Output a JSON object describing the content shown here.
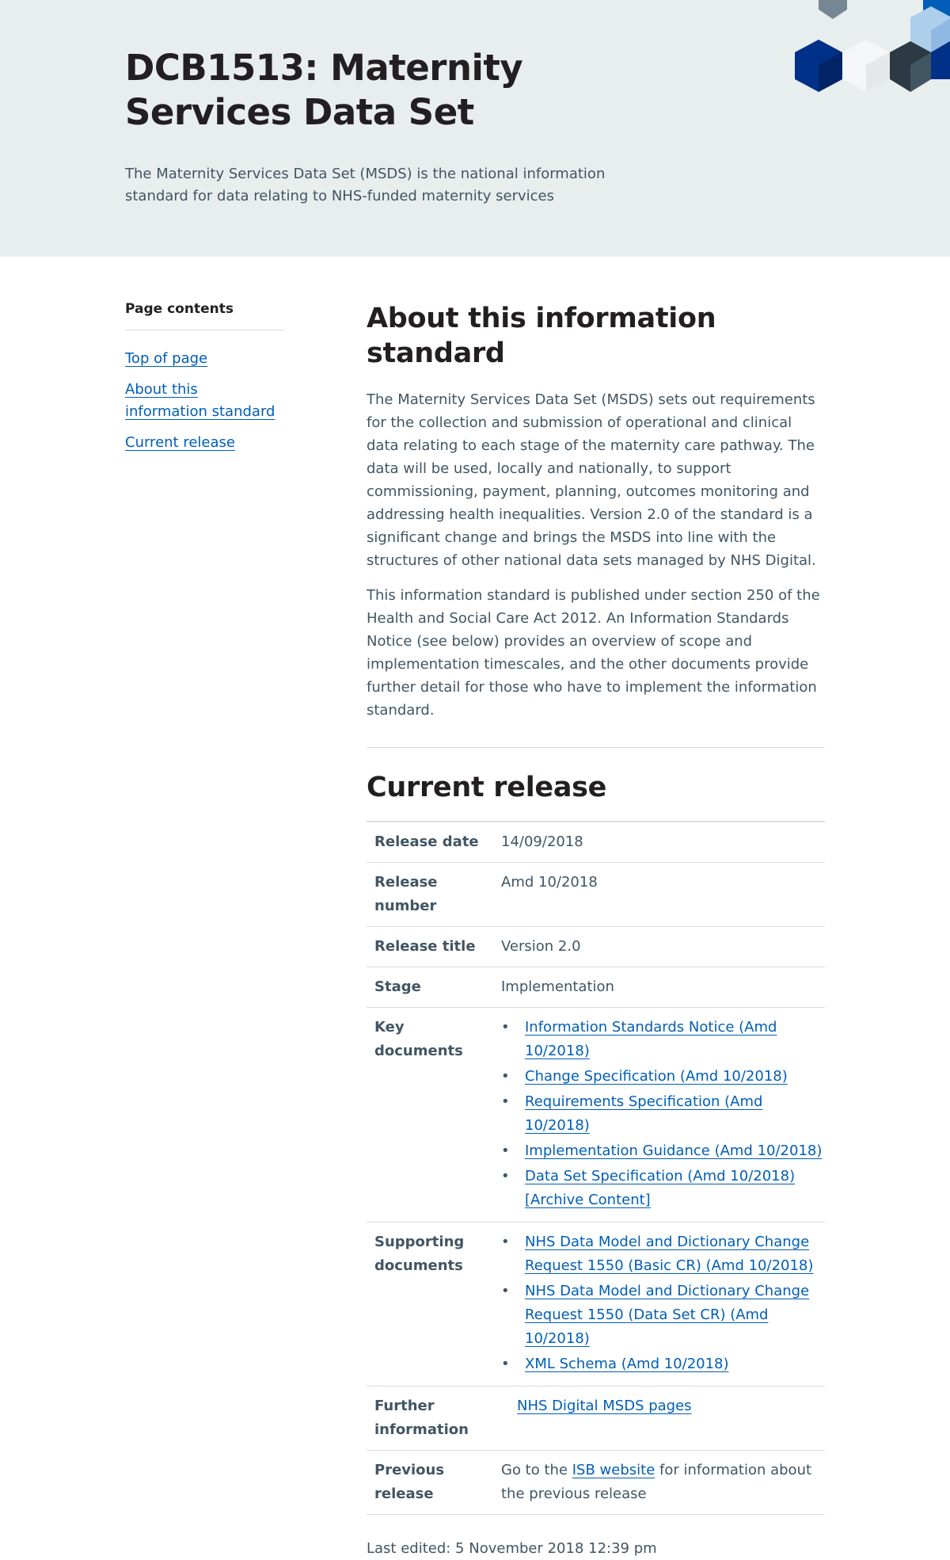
{
  "header": {
    "title": "DCB1513: Maternity Services Data Set",
    "lede": "The Maternity Services Data Set (MSDS) is the national information standard for data relating to NHS-funded maternity services"
  },
  "toc": {
    "heading": "Page contents",
    "items": [
      {
        "label": "Top of page"
      },
      {
        "label": "About this information standard"
      },
      {
        "label": "Current release"
      }
    ]
  },
  "about": {
    "heading": "About this information standard",
    "p1": "The Maternity Services Data Set (MSDS) sets out requirements for the collection and submission of operational and clinical data relating to each stage of the maternity care pathway. The data will be used, locally and nationally, to support commissioning, payment, planning, outcomes monitoring and addressing health inequalities. Version 2.0 of the standard is a significant change and brings the MSDS into line with the structures of other national data sets managed by NHS Digital.",
    "p2": "This information standard is published under section 250 of the Health and Social Care Act 2012. An Information Standards Notice (see below) provides an overview of scope and implementation timescales, and the other documents provide further detail for those who have to implement the information standard."
  },
  "release": {
    "heading": "Current release",
    "release_date_label": "Release date",
    "release_date": "14/09/2018",
    "release_number_label": "Release number",
    "release_number": "Amd 10/2018",
    "release_title_label": "Release title",
    "release_title": "Version 2.0",
    "stage_label": "Stage",
    "stage": "Implementation",
    "key_documents_label": "Key documents",
    "key_documents": [
      "Information Standards Notice (Amd 10/2018)",
      "Change Specification (Amd 10/2018)",
      "Requirements Specification (Amd 10/2018)",
      "Implementation Guidance (Amd 10/2018)",
      "Data Set Specification (Amd 10/2018) [Archive Content]"
    ],
    "supporting_documents_label": "Supporting documents",
    "supporting_documents": [
      "NHS Data Model and Dictionary Change Request 1550 (Basic CR) (Amd 10/2018)",
      "NHS Data Model and Dictionary Change Request 1550 (Data Set CR) (Amd 10/2018)",
      "XML Schema (Amd 10/2018)"
    ],
    "further_info_label": "Further information",
    "further_info_link": "NHS Digital MSDS pages",
    "previous_release_label": "Previous release",
    "previous_release_before": "Go to the ",
    "previous_release_link": "ISB website",
    "previous_release_after": " for information about the previous release"
  },
  "last_edited": "Last edited: 5 November 2018 12:39 pm",
  "colors": {
    "link": "#005eb8",
    "hero_bg": "#e8edee",
    "text": "#425563",
    "heading": "#231f20"
  }
}
